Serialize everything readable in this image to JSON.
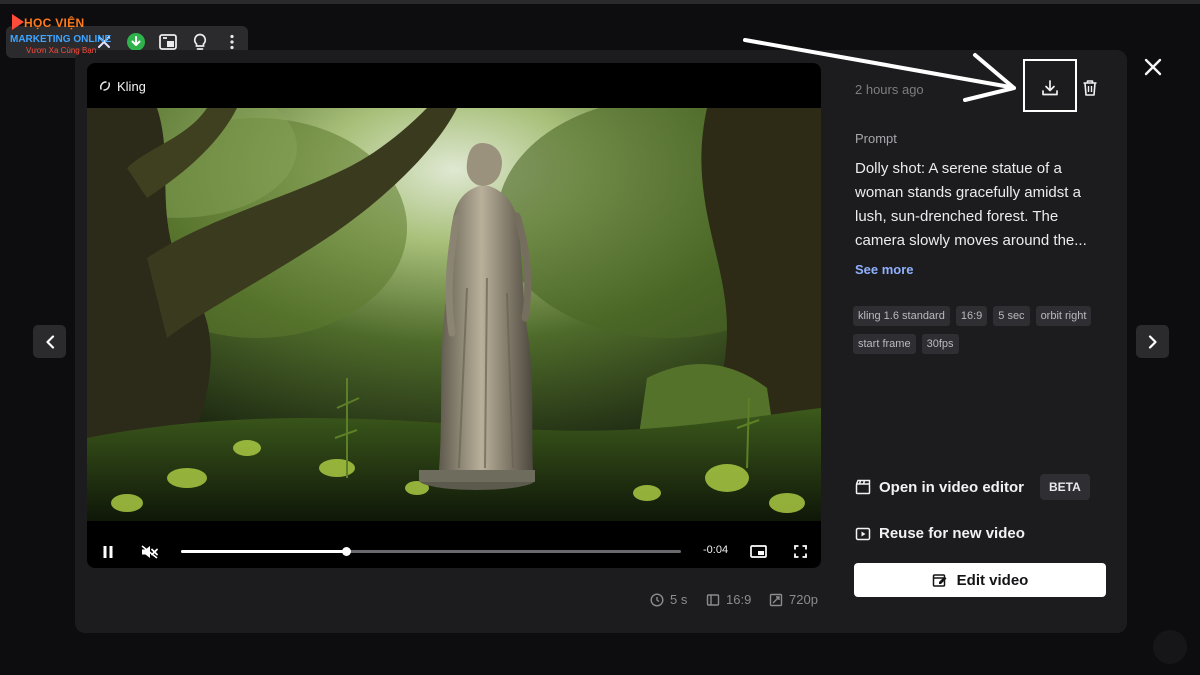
{
  "brand": {
    "line1": "HỌC VIỆN",
    "line2": "MARKETING ONLINE",
    "line3": "Vươn Xa Cùng Bạn"
  },
  "toolbar": {
    "items": [
      "close-icon",
      "download-circle-icon",
      "picture-in-picture-icon",
      "lightbulb-icon",
      "more-vertical-icon"
    ]
  },
  "player": {
    "model_label": "Kling",
    "time_remaining": "-0:04",
    "progress": 0.33,
    "playing": true,
    "muted": true
  },
  "video_meta": {
    "duration": "5 s",
    "aspect": "16:9",
    "resolution": "720p"
  },
  "panel": {
    "time_ago": "2 hours ago",
    "prompt_label": "Prompt",
    "prompt_text": "Dolly shot: A serene statue of a woman stands gracefully amidst a lush, sun-drenched forest. The camera slowly moves around the...",
    "see_more": "See more",
    "tags": [
      "kling 1.6 standard",
      "16:9",
      "5 sec",
      "orbit right",
      "start frame",
      "30fps"
    ],
    "open_editor": "Open in video editor",
    "beta": "BETA",
    "reuse": "Reuse for new video",
    "edit_video": "Edit video"
  },
  "colors": {
    "background": "#0d0d0f",
    "modal": "#1c1c1e",
    "accent_link": "#8fb0ff",
    "button_primary": "#ffffff"
  }
}
